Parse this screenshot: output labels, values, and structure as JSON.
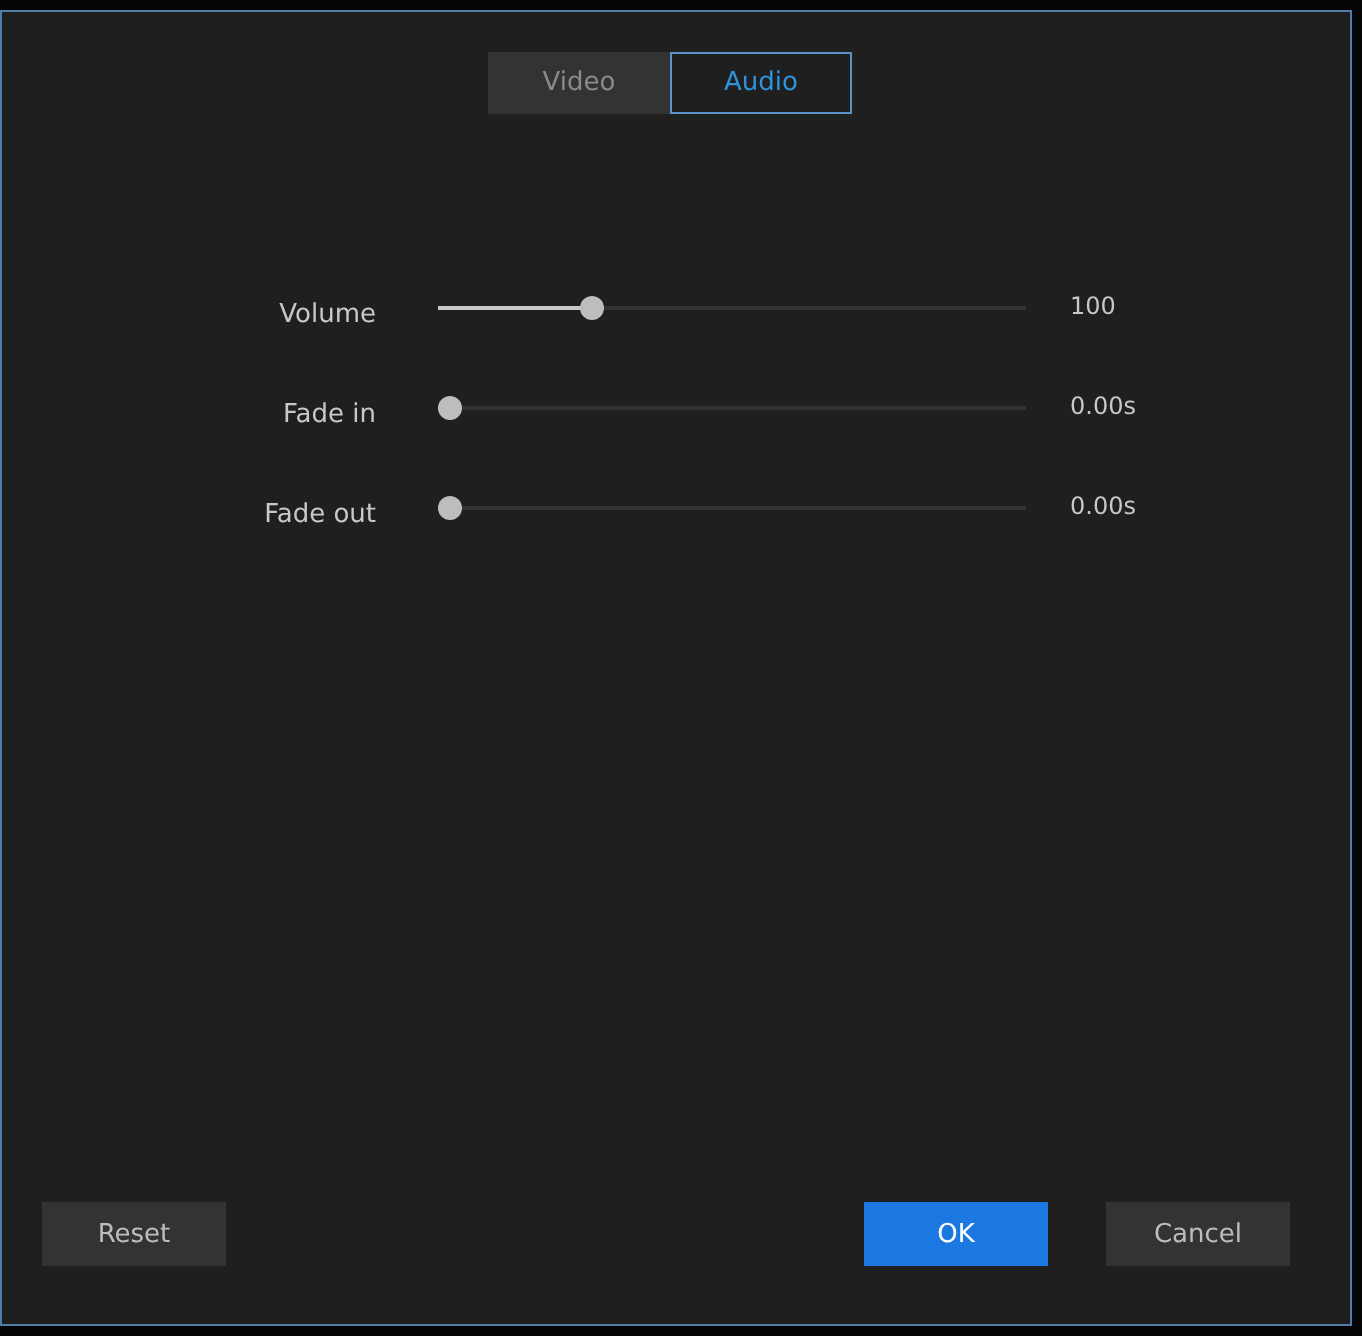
{
  "tabs": [
    {
      "label": "Video",
      "selected": false
    },
    {
      "label": "Audio",
      "selected": true
    }
  ],
  "sliders": [
    {
      "label": "Volume",
      "level": 0.25,
      "reading": "100"
    },
    {
      "label": "Fade in",
      "level": 0,
      "reading": "0.00s"
    },
    {
      "label": "Fade out",
      "level": 0,
      "reading": "0.00s"
    }
  ],
  "buttons": [
    {
      "label": "Reset",
      "kind": "secondary"
    },
    {
      "label": "OK",
      "kind": "primary"
    },
    {
      "label": "Cancel",
      "kind": "secondary"
    }
  ]
}
